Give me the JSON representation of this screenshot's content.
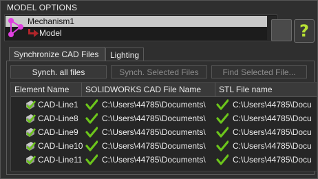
{
  "window": {
    "title": "MODEL OPTIONS"
  },
  "tree": {
    "root_label": "Mechanism1",
    "child_label": "Model"
  },
  "help_button": {
    "label": "?"
  },
  "tabs": [
    {
      "label": "Synchronize CAD Files",
      "active": true
    },
    {
      "label": "Lighting",
      "active": false
    }
  ],
  "toolbar": {
    "synch_all": "Synch. all files",
    "synch_selected": "Synch. Selected Files",
    "find_selected": "Find Selected File..."
  },
  "table": {
    "columns": [
      "Element Name",
      "SOLIDWORKS CAD File Name",
      "STL File name"
    ],
    "rows": [
      {
        "name": "CAD-Line1",
        "cad_file": "C:\\Users\\44785\\Documents\\",
        "stl_file": "C:\\Users\\44785\\Docu"
      },
      {
        "name": "CAD-Line8",
        "cad_file": "C:\\Users\\44785\\Documents\\",
        "stl_file": "C:\\Users\\44785\\Docu"
      },
      {
        "name": "CAD-Line9",
        "cad_file": "C:\\Users\\44785\\Documents\\",
        "stl_file": "C:\\Users\\44785\\Docu"
      },
      {
        "name": "CAD-Line10",
        "cad_file": "C:\\Users\\44785\\Documents\\",
        "stl_file": "C:\\Users\\44785\\Docu"
      },
      {
        "name": "CAD-Line11",
        "cad_file": "C:\\Users\\44785\\Documents\\",
        "stl_file": "C:\\Users\\44785\\Docu"
      }
    ]
  },
  "icons": {
    "mechanism": "mechanism-icon",
    "model_arrow": "red-arrow-icon",
    "element": "cad-part-check-icon",
    "status": "green-check-icon"
  },
  "colors": {
    "background": "#2f2f2f",
    "selection": "#c9c9c9",
    "accent_green": "#b7e234",
    "check_green": "#6cc51b",
    "mechanism_magenta": "#e040e0",
    "arrow_red": "#b0252a"
  }
}
